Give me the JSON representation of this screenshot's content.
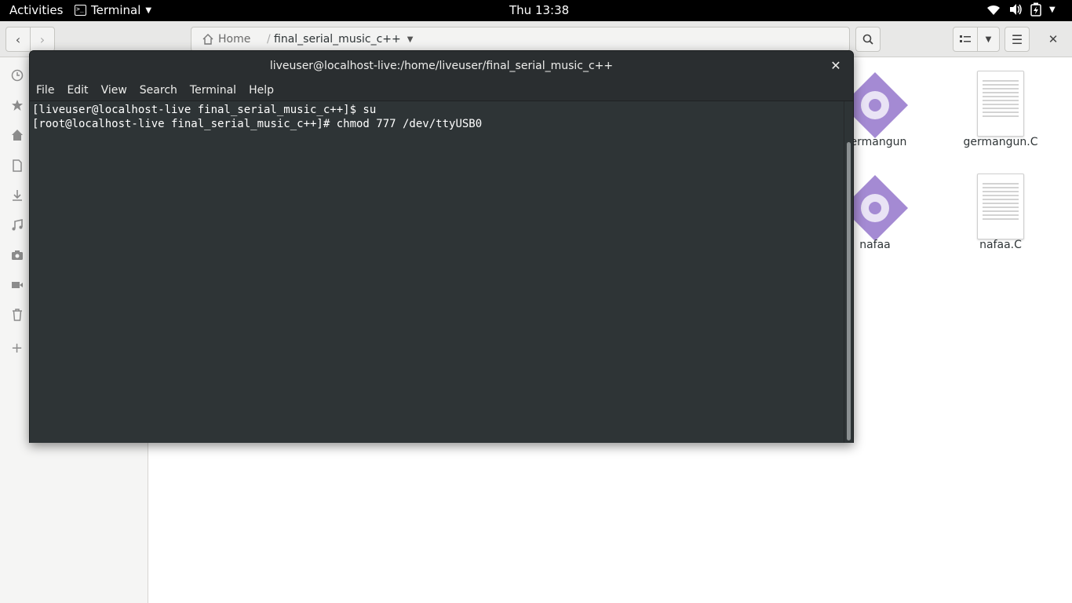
{
  "topbar": {
    "activities": "Activities",
    "app_name": "Terminal",
    "clock": "Thu 13:38"
  },
  "files": {
    "path_home": "Home",
    "path_folder": "final_serial_music_c++",
    "items": [
      {
        "label": "germangun",
        "kind": "executable"
      },
      {
        "label": "germangun.C",
        "kind": "document"
      },
      {
        "label": "nafaa",
        "kind": "executable"
      },
      {
        "label": "nafaa.C",
        "kind": "document"
      }
    ]
  },
  "terminal": {
    "title": "liveuser@localhost-live:/home/liveuser/final_serial_music_c++",
    "menu": [
      "File",
      "Edit",
      "View",
      "Search",
      "Terminal",
      "Help"
    ],
    "lines": [
      "[liveuser@localhost-live final_serial_music_c++]$ su",
      "[root@localhost-live final_serial_music_c++]# chmod 777 /dev/ttyUSB0"
    ]
  },
  "colors": {
    "terminal_bg": "#2e3436",
    "topbar_bg": "#000000",
    "exec_icon": "#a48ad3"
  }
}
